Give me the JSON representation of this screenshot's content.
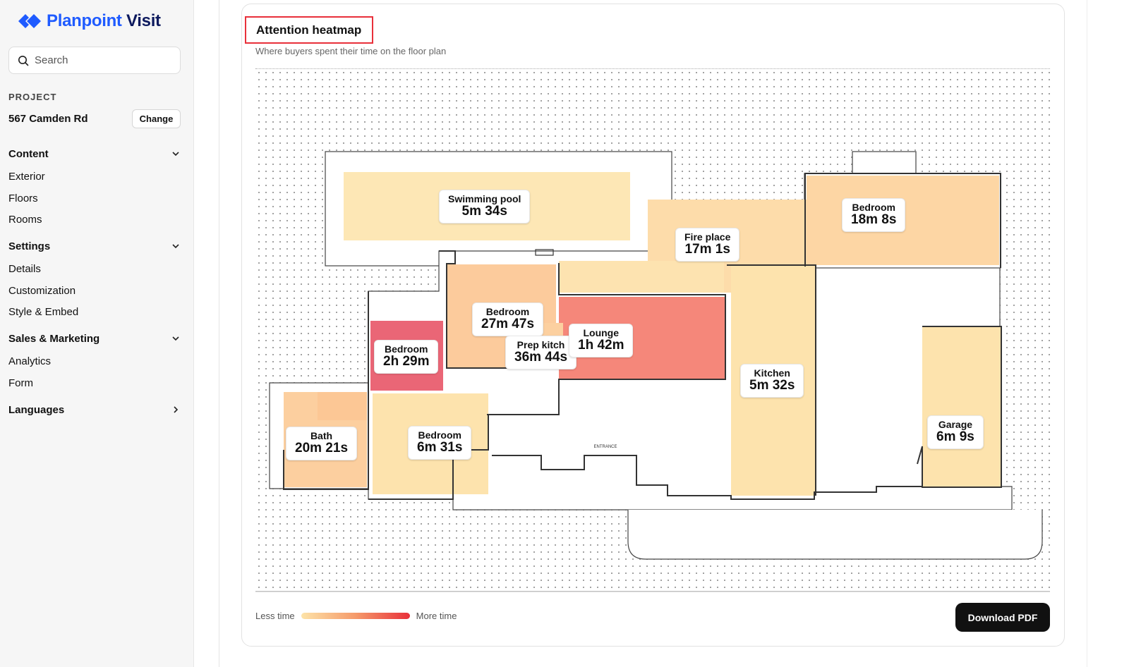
{
  "brand": {
    "name_part1": "Planpoint",
    "name_part2": "Visit"
  },
  "search": {
    "placeholder": "Search"
  },
  "project": {
    "label": "PROJECT",
    "name": "567 Camden Rd",
    "change_label": "Change"
  },
  "nav": {
    "content": {
      "label": "Content",
      "items": [
        "Exterior",
        "Floors",
        "Rooms"
      ]
    },
    "settings": {
      "label": "Settings",
      "items": [
        "Details",
        "Customization",
        "Style & Embed"
      ]
    },
    "sales": {
      "label": "Sales & Marketing",
      "items": [
        "Analytics",
        "Form"
      ]
    },
    "languages": {
      "label": "Languages"
    }
  },
  "heatmap": {
    "title": "Attention heatmap",
    "subtitle": "Where buyers spent their time on the floor plan",
    "rooms": [
      {
        "name": "Swimming pool",
        "time": "5m 34s"
      },
      {
        "name": "Fire place",
        "time": "17m 1s"
      },
      {
        "name": "Bedroom",
        "time": "18m 8s"
      },
      {
        "name": "Bedroom",
        "time": "27m 47s"
      },
      {
        "name": "Lounge",
        "time": "1h 42m"
      },
      {
        "name": "Prep kitch",
        "time": "36m 44s"
      },
      {
        "name": "Bedroom",
        "time": "2h 29m"
      },
      {
        "name": "Kitchen",
        "time": "5m 32s"
      },
      {
        "name": "Garage",
        "time": "6m 9s"
      },
      {
        "name": "Bath",
        "time": "20m 21s"
      },
      {
        "name": "Bedroom",
        "time": "6m 31s"
      }
    ],
    "plan_labels": {
      "entrance": "ENTRANCE"
    },
    "legend": {
      "less": "Less time",
      "more": "More time"
    },
    "download_label": "Download PDF"
  },
  "colors": {
    "accent": "#1f5bff",
    "hot": "#e8303a",
    "warm": "#f59a6a",
    "cool": "#fde3a8"
  }
}
